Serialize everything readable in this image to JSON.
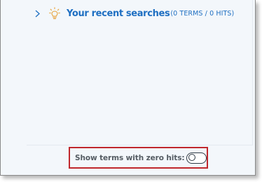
{
  "recent_searches": {
    "title": "Your recent searches",
    "count": "(0 TERMS / 0 HITS)",
    "expanded": false,
    "chevron_icon": "chevron-right-icon",
    "bulb_icon": "lightbulb-icon",
    "accent_color": "#1e6fc2",
    "bulb_color": "#e8a33c"
  },
  "footer": {
    "zero_hits_label": "Show terms with zero hits:",
    "zero_hits_toggle_on": false,
    "highlight_color": "#c0282d"
  }
}
